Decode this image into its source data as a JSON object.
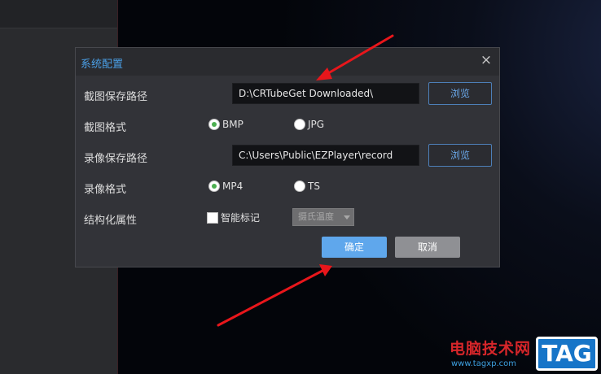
{
  "dialog": {
    "title": "系统配置",
    "close_symbol": "×",
    "snapshot_path": {
      "label": "截图保存路径",
      "value": "D:\\CRTubeGet Downloaded\\",
      "browse": "浏览"
    },
    "snapshot_format": {
      "label": "截图格式",
      "options": [
        "BMP",
        "JPG"
      ],
      "selected": "BMP"
    },
    "record_path": {
      "label": "录像保存路径",
      "value": "C:\\Users\\Public\\EZPlayer\\record",
      "browse": "浏览"
    },
    "record_format": {
      "label": "录像格式",
      "options": [
        "MP4",
        "TS"
      ],
      "selected": "MP4"
    },
    "structured": {
      "label": "结构化属性",
      "checkbox_label": "智能标记",
      "checked": false,
      "select_value": "摄氏温度"
    },
    "ok": "确定",
    "cancel": "取消"
  },
  "watermark": {
    "text": "电脑技术网",
    "url": "www.tagxp.com",
    "tag": "TAG"
  },
  "colors": {
    "title": "#4a9fe6",
    "ok_button": "#5fa7ec",
    "cancel_button": "#8f9094",
    "annotation_arrow": "#e8161b"
  }
}
